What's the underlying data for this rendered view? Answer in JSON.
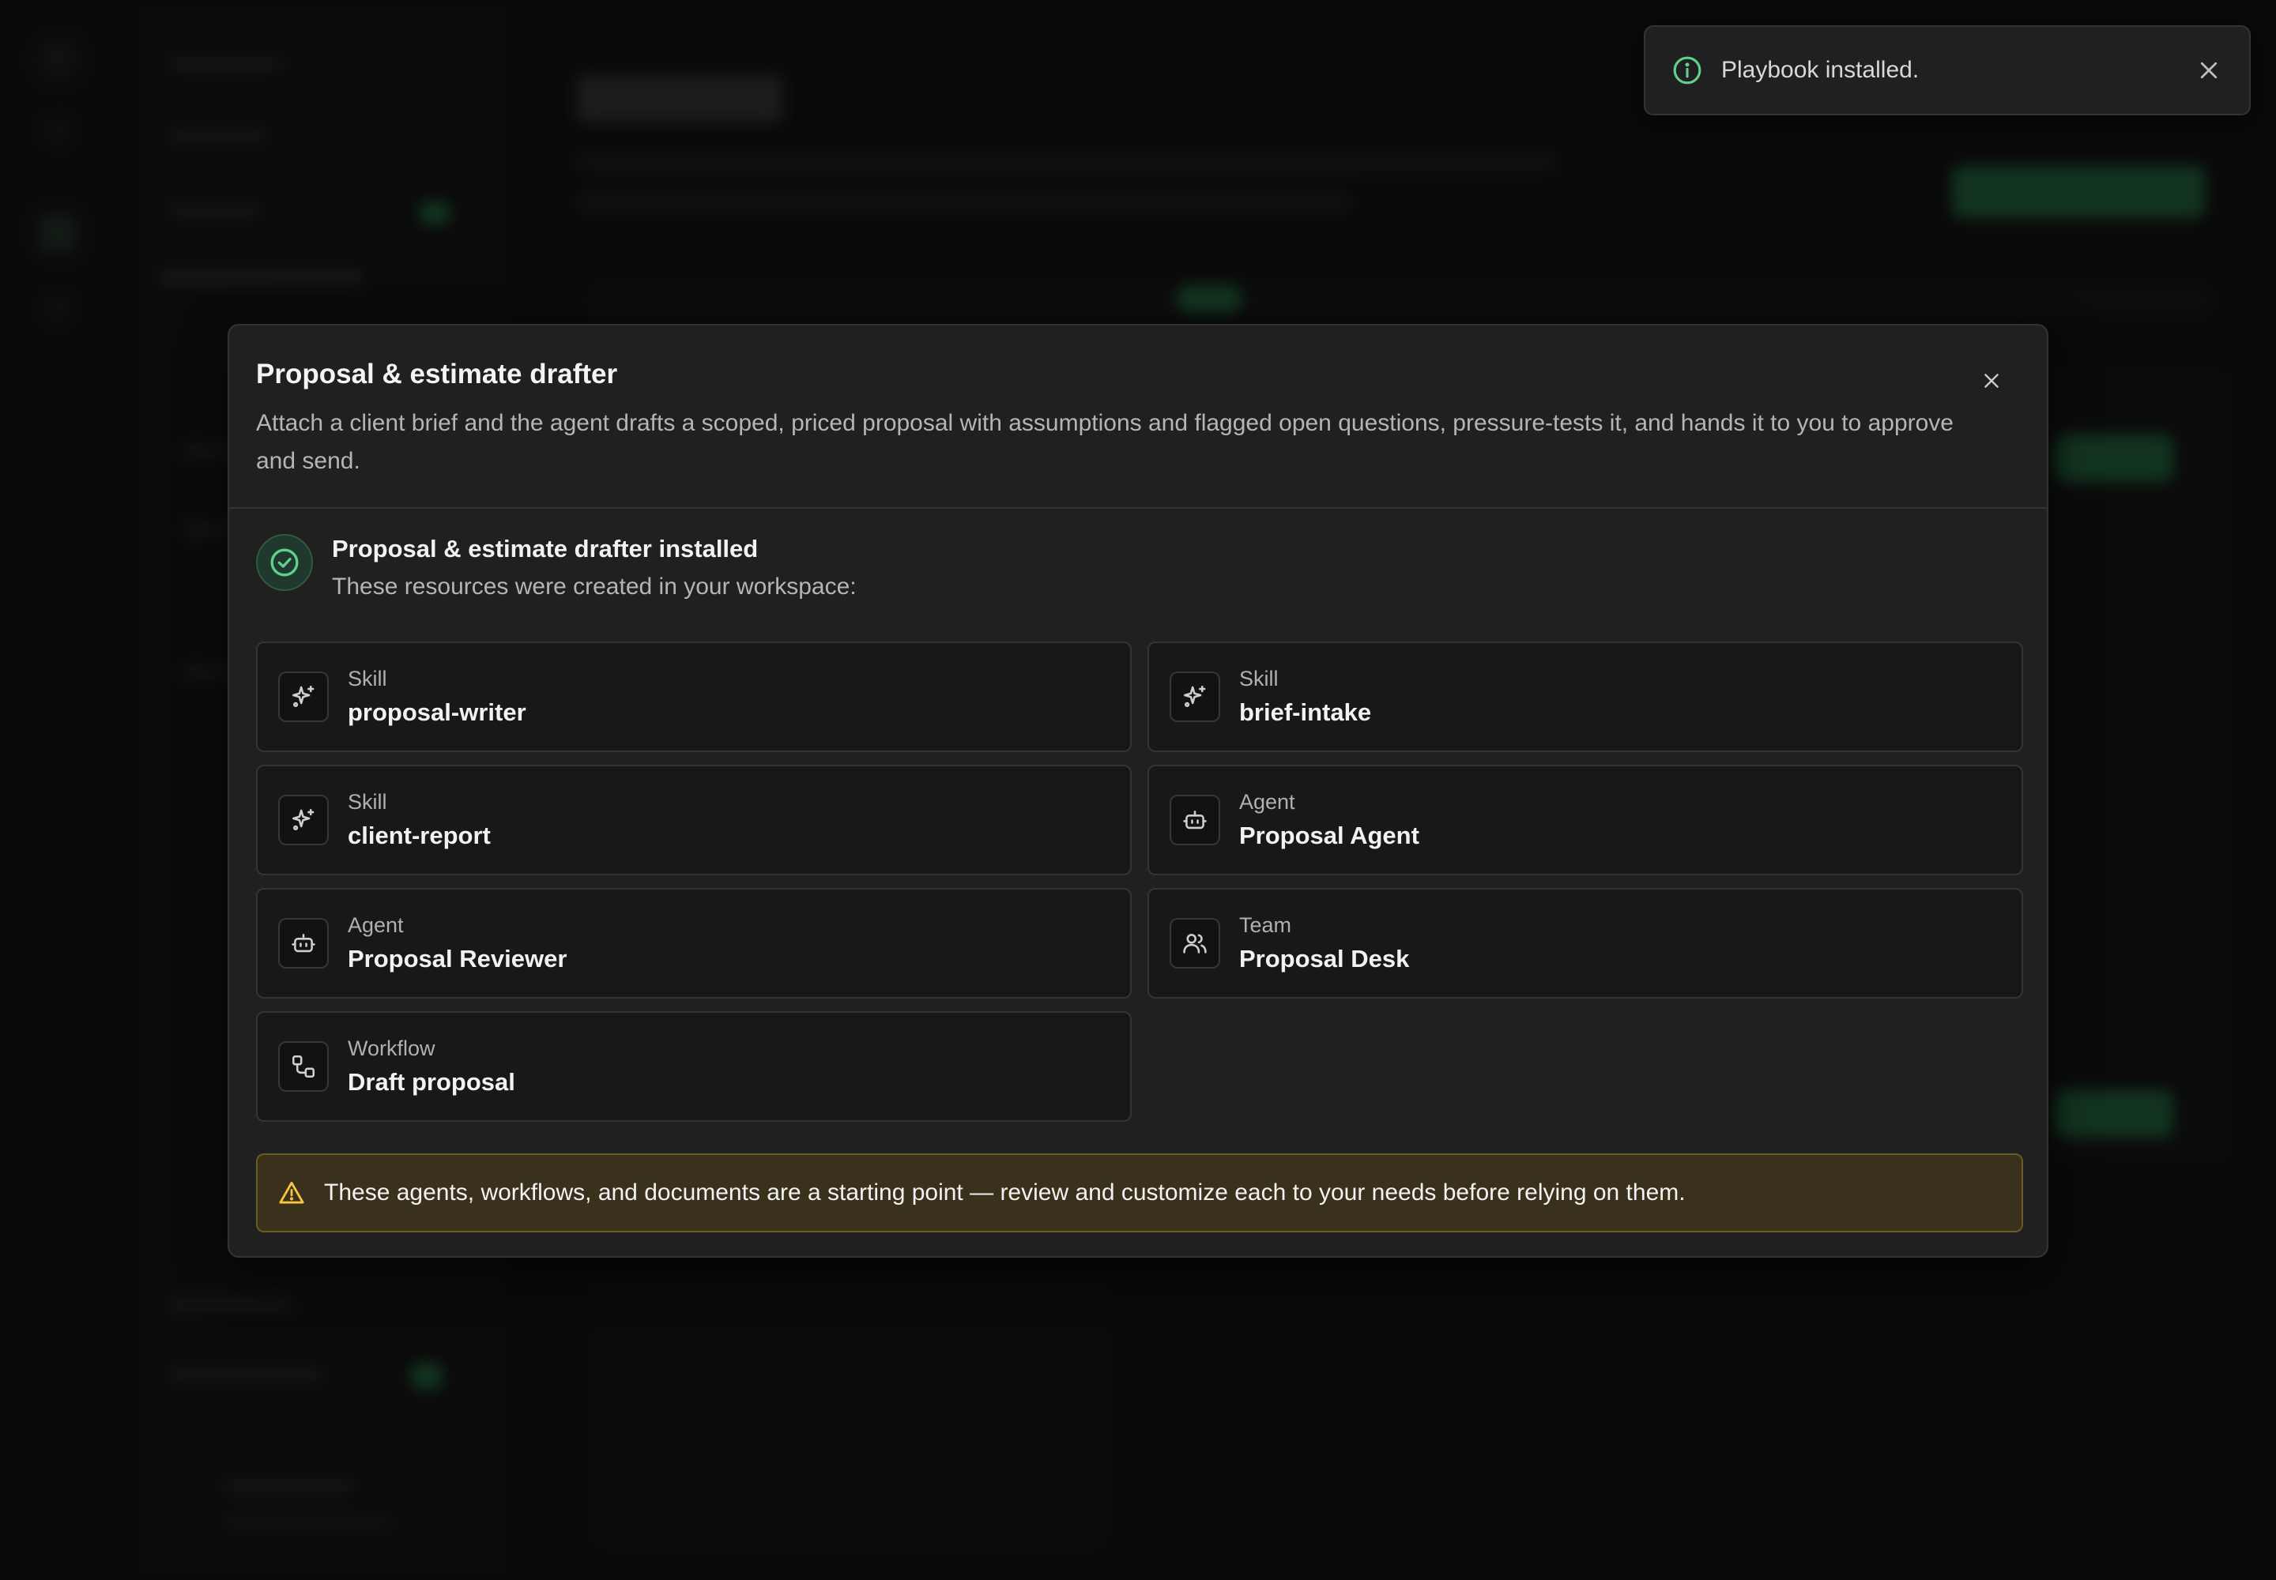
{
  "toast": {
    "icon": "info-icon",
    "message": "Playbook installed.",
    "close_icon": "close-icon"
  },
  "modal": {
    "title": "Proposal & estimate drafter",
    "description": "Attach a client brief and the agent drafts a scoped, priced proposal with assumptions and flagged open questions, pressure-tests it, and hands it to you to approve and send.",
    "close_icon": "close-icon",
    "installed": {
      "icon": "check-circle-icon",
      "title": "Proposal & estimate drafter installed",
      "subtitle": "These resources were created in your workspace:"
    },
    "resources": [
      {
        "type": "Skill",
        "name": "proposal-writer",
        "icon": "sparkles-icon"
      },
      {
        "type": "Skill",
        "name": "brief-intake",
        "icon": "sparkles-icon"
      },
      {
        "type": "Skill",
        "name": "client-report",
        "icon": "sparkles-icon"
      },
      {
        "type": "Agent",
        "name": "Proposal Agent",
        "icon": "bot-icon"
      },
      {
        "type": "Agent",
        "name": "Proposal Reviewer",
        "icon": "bot-icon"
      },
      {
        "type": "Team",
        "name": "Proposal Desk",
        "icon": "users-icon"
      },
      {
        "type": "Workflow",
        "name": "Draft proposal",
        "icon": "workflow-icon"
      }
    ],
    "warning": {
      "icon": "warning-triangle-icon",
      "text": "These agents, workflows, and documents are a starting point — review and customize each to your needs before relying on them."
    }
  },
  "colors": {
    "page_bg": "#121212",
    "modal_bg": "#202020",
    "card_bg": "#181818",
    "success": "#5fd08d",
    "warning_bg": "#3a311c",
    "warning_border": "#6b5a22",
    "warning_icon": "#f5c542"
  }
}
